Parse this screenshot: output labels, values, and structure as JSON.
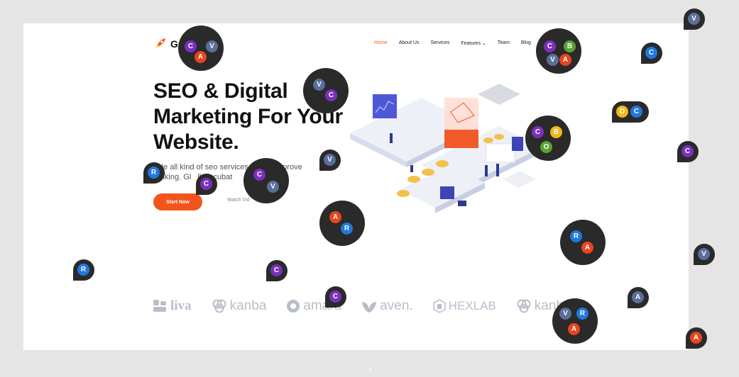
{
  "header": {
    "logo_text": "Gr",
    "nav": [
      "Home",
      "About Us",
      "Services",
      "Features",
      "Team",
      "Blog"
    ],
    "active": "Home",
    "features_caret": "⌄"
  },
  "hero": {
    "title_line1": "SEO & Digital",
    "title_line2": "Marketing For Your",
    "title_line3": "Website.",
    "desc_line1": "vide all kind of seo services         o improve",
    "desc_line2": "ranking. Gl   lly incubat",
    "start_label": "Start Now",
    "watch_label": "Watch Vid"
  },
  "brands": [
    "liva",
    "kanba",
    "amara",
    "aven.",
    "HEXLAB",
    "kanba"
  ],
  "colors": {
    "C": "#7b2fbe",
    "V": "#5b6e9a",
    "A": "#e8451f",
    "R": "#1f78e0",
    "B": "#f3b815",
    "O": "#5aa332",
    "D": "#f3b815",
    "accent": "#ff5a1f"
  },
  "collab": {
    "letters": [
      "C",
      "V",
      "A",
      "R",
      "B",
      "O",
      "D"
    ]
  }
}
